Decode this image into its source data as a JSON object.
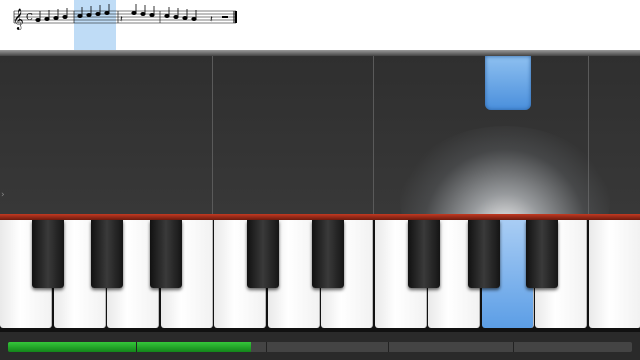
{
  "score": {
    "clef": "treble-clef-icon",
    "time_signature": "C",
    "highlight_color": "#bfdcf6"
  },
  "falling_note": {
    "color": "#4a8fdc"
  },
  "keyboard": {
    "white_key_count": 12,
    "active_white_key_index": 9,
    "active_color": "#5c9ee6"
  },
  "progress": {
    "fraction": 0.39,
    "color": "#22a82a"
  }
}
